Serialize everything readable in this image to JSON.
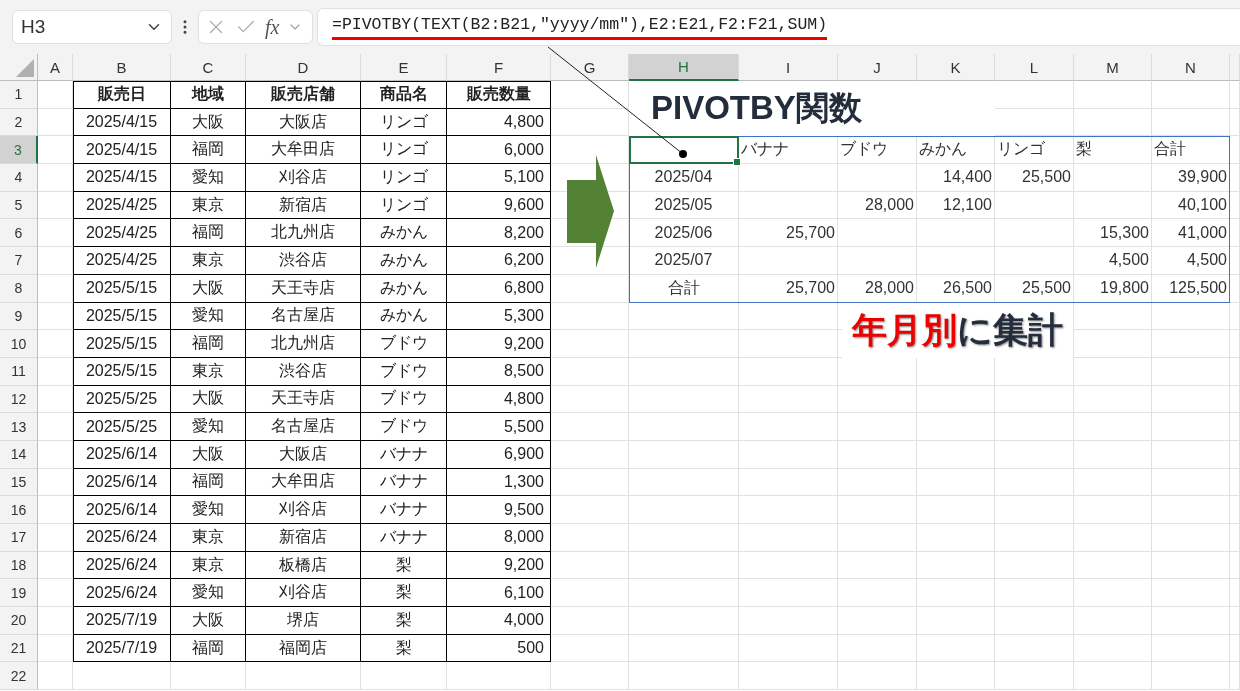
{
  "name_box": {
    "value": "H3"
  },
  "formula_bar": {
    "function_label": "fx",
    "formula": "=PIVOTBY(TEXT(B2:B21,\"yyyy/mm\"),E2:E21,F2:F21,SUM)"
  },
  "column_headers": [
    {
      "label": "A",
      "selected": false
    },
    {
      "label": "B",
      "selected": false
    },
    {
      "label": "C",
      "selected": false
    },
    {
      "label": "D",
      "selected": false
    },
    {
      "label": "E",
      "selected": false
    },
    {
      "label": "F",
      "selected": false
    },
    {
      "label": "G",
      "selected": false
    },
    {
      "label": "H",
      "selected": true
    },
    {
      "label": "I",
      "selected": false
    },
    {
      "label": "J",
      "selected": false
    },
    {
      "label": "K",
      "selected": false
    },
    {
      "label": "L",
      "selected": false
    },
    {
      "label": "M",
      "selected": false
    },
    {
      "label": "N",
      "selected": false
    }
  ],
  "row_headers": [
    {
      "label": "1",
      "selected": false
    },
    {
      "label": "2",
      "selected": false
    },
    {
      "label": "3",
      "selected": true
    },
    {
      "label": "4",
      "selected": false
    },
    {
      "label": "5",
      "selected": false
    },
    {
      "label": "6",
      "selected": false
    },
    {
      "label": "7",
      "selected": false
    },
    {
      "label": "8",
      "selected": false
    },
    {
      "label": "9",
      "selected": false
    },
    {
      "label": "10",
      "selected": false
    },
    {
      "label": "11",
      "selected": false
    },
    {
      "label": "12",
      "selected": false
    },
    {
      "label": "13",
      "selected": false
    },
    {
      "label": "14",
      "selected": false
    },
    {
      "label": "15",
      "selected": false
    },
    {
      "label": "16",
      "selected": false
    },
    {
      "label": "17",
      "selected": false
    },
    {
      "label": "18",
      "selected": false
    },
    {
      "label": "19",
      "selected": false
    },
    {
      "label": "20",
      "selected": false
    },
    {
      "label": "21",
      "selected": false
    },
    {
      "label": "22",
      "selected": false
    }
  ],
  "sales_table": {
    "columns": [
      "販売日",
      "地域",
      "販売店舗",
      "商品名",
      "販売数量"
    ],
    "rows": [
      [
        "2025/4/15",
        "大阪",
        "大阪店",
        "リンゴ",
        "4,800"
      ],
      [
        "2025/4/15",
        "福岡",
        "大牟田店",
        "リンゴ",
        "6,000"
      ],
      [
        "2025/4/15",
        "愛知",
        "刈谷店",
        "リンゴ",
        "5,100"
      ],
      [
        "2025/4/25",
        "東京",
        "新宿店",
        "リンゴ",
        "9,600"
      ],
      [
        "2025/4/25",
        "福岡",
        "北九州店",
        "みかん",
        "8,200"
      ],
      [
        "2025/4/25",
        "東京",
        "渋谷店",
        "みかん",
        "6,200"
      ],
      [
        "2025/5/15",
        "大阪",
        "天王寺店",
        "みかん",
        "6,800"
      ],
      [
        "2025/5/15",
        "愛知",
        "名古屋店",
        "みかん",
        "5,300"
      ],
      [
        "2025/5/15",
        "福岡",
        "北九州店",
        "ブドウ",
        "9,200"
      ],
      [
        "2025/5/15",
        "東京",
        "渋谷店",
        "ブドウ",
        "8,500"
      ],
      [
        "2025/5/25",
        "大阪",
        "天王寺店",
        "ブドウ",
        "4,800"
      ],
      [
        "2025/5/25",
        "愛知",
        "名古屋店",
        "ブドウ",
        "5,500"
      ],
      [
        "2025/6/14",
        "大阪",
        "大阪店",
        "バナナ",
        "6,900"
      ],
      [
        "2025/6/14",
        "福岡",
        "大牟田店",
        "バナナ",
        "1,300"
      ],
      [
        "2025/6/14",
        "愛知",
        "刈谷店",
        "バナナ",
        "9,500"
      ],
      [
        "2025/6/24",
        "東京",
        "新宿店",
        "バナナ",
        "8,000"
      ],
      [
        "2025/6/24",
        "東京",
        "板橋店",
        "梨",
        "9,200"
      ],
      [
        "2025/6/24",
        "愛知",
        "刈谷店",
        "梨",
        "6,100"
      ],
      [
        "2025/7/19",
        "大阪",
        "堺店",
        "梨",
        "4,000"
      ],
      [
        "2025/7/19",
        "福岡",
        "福岡店",
        "梨",
        "500"
      ]
    ]
  },
  "pivot": {
    "title": "PIVOTBY関数",
    "columns": [
      "バナナ",
      "ブドウ",
      "みかん",
      "リンゴ",
      "梨",
      "合計"
    ],
    "rows": [
      {
        "label": "2025/04",
        "column_3": "14,400",
        "column_4": "25,500",
        "column_6": "39,900"
      },
      {
        "label": "2025/05",
        "column_2": "28,000",
        "column_3": "12,100",
        "column_6": "40,100"
      },
      {
        "label": "2025/06",
        "column_1": "25,700",
        "column_5": "15,300",
        "column_6": "41,000"
      },
      {
        "label": "2025/07",
        "column_5": "4,500",
        "column_6": "4,500"
      },
      {
        "label": "合計",
        "column_1": "25,700",
        "column_2": "28,000",
        "column_3": "26,500",
        "column_4": "25,500",
        "column_5": "19,800",
        "column_6": "125,500"
      }
    ]
  },
  "callout": {
    "highlight": "年月別",
    "rest": "に集計"
  }
}
